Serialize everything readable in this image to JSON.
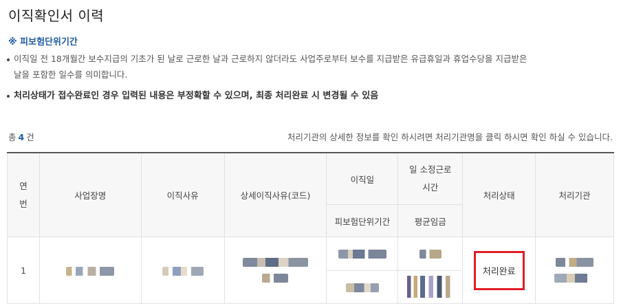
{
  "page": {
    "title": "이직확인서 이력",
    "subhead": "※ 피보험단위기간",
    "note1_line1": "이직일 전 18개월간 보수지급의 기초가 된 날로 근로한 날과 근로하지 않더라도 사업주로부터 보수를 지급받은 유급휴일과 휴업수당을 지급받은",
    "note1_line2": "날을 포함한 일수를 의미합니다.",
    "note2": "처리상태가 접수완료인 경우 입력된 내용은 부정확할 수 있으며, 최종 처리완료 시 변경될 수 있음"
  },
  "summary": {
    "total_prefix": "총",
    "total_count": "4",
    "total_suffix": "건",
    "hint": "처리기관의 상세한 정보를 확인 하시려면 처리기관명을 클릭 하시면 확인 하실 수 있습니다."
  },
  "table": {
    "headers": {
      "no": "연번",
      "workplace": "사업장명",
      "reason": "이직사유",
      "detail_reason": "상세이직사유(코드)",
      "leave_date": "이직일",
      "insured_period": "피보험단위기간",
      "work_hours": "일 소정근로시간",
      "avg_wage": "평균임금",
      "status": "처리상태",
      "agency": "처리기관"
    },
    "rows": [
      {
        "no": "1",
        "status": "처리완료"
      }
    ]
  },
  "colors": {
    "accent": "#1f5aa6",
    "highlight": "#e11c25"
  }
}
